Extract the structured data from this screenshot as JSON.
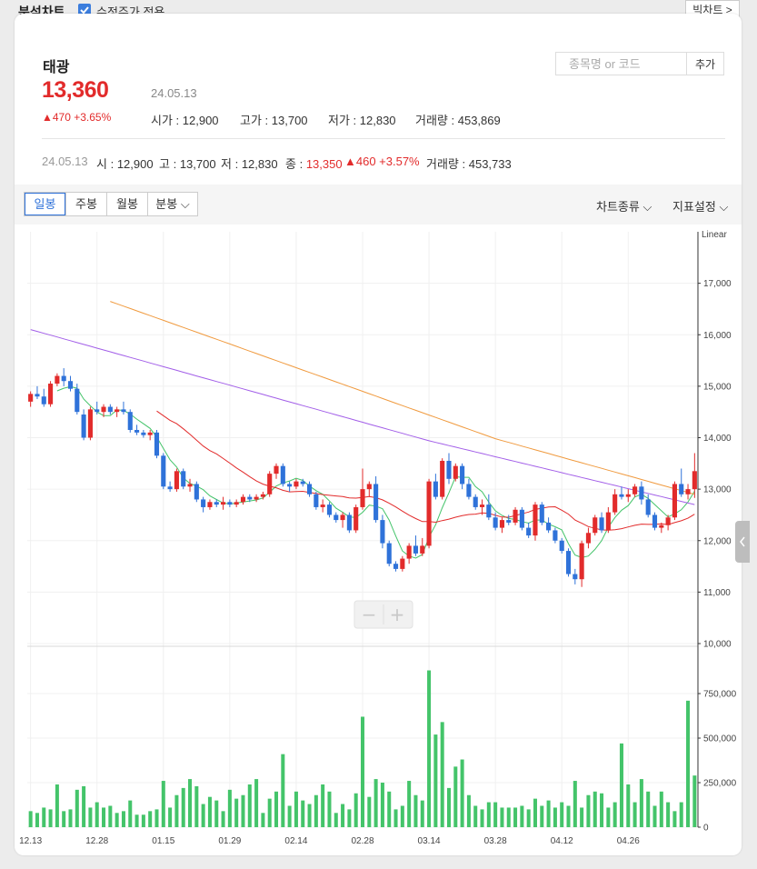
{
  "top": {
    "title": "분석차트",
    "checkbox_label": "수정주가 적용",
    "checkbox_checked": true,
    "big_chart_button": "빅차트 >"
  },
  "stock": {
    "name": "태광",
    "price": "13,360",
    "date": "24.05.13",
    "change": "▲470 +3.65%",
    "open_label": "시가",
    "open": "12,900",
    "high_label": "고가",
    "high": "13,700",
    "low_label": "저가",
    "low": "12,830",
    "vol_label": "거래량",
    "vol": "453,869"
  },
  "search": {
    "placeholder": "종목명 or 코드",
    "add_button": "추가"
  },
  "summary": {
    "date": "24.05.13",
    "o_label": "시",
    "o": "12,900",
    "h_label": "고",
    "h": "13,700",
    "l_label": "저",
    "l": "12,830",
    "c_label": "종",
    "c": "13,350",
    "chg": "▲460 +3.57%",
    "v_label": "거래량",
    "v": "453,733"
  },
  "tabs": {
    "items": [
      "일봉",
      "주봉",
      "월봉",
      "분봉"
    ],
    "active": 0
  },
  "controls": {
    "chart_type": "차트종류",
    "indicator": "지표설정"
  },
  "colors": {
    "up": "#e22b2b",
    "down": "#2f72d9",
    "volume": "#44c46a",
    "ma5": "#44c46a",
    "ma20": "#e22b2b",
    "ma60": "#a25ee8",
    "ma120": "#f09a3e",
    "accent": "#2f72d9"
  },
  "zoom": {
    "minus": "−",
    "plus": "+"
  },
  "chart_data": {
    "type": "candlestick",
    "scale_label": "Linear",
    "price_ticks": [
      "10,000",
      "11,000",
      "12,000",
      "13,000",
      "14,000",
      "15,000",
      "16,000",
      "17,000"
    ],
    "price_range": [
      10000,
      18000
    ],
    "volume_ticks": [
      "0",
      "250,000",
      "500,000",
      "750,000"
    ],
    "volume_range": [
      0,
      1000000
    ],
    "x_labels": [
      {
        "i": 0,
        "label": "12.13"
      },
      {
        "i": 10,
        "label": "12.28"
      },
      {
        "i": 20,
        "label": "01.15"
      },
      {
        "i": 30,
        "label": "01.29"
      },
      {
        "i": 40,
        "label": "02.14"
      },
      {
        "i": 50,
        "label": "02.28"
      },
      {
        "i": 60,
        "label": "03.14"
      },
      {
        "i": 70,
        "label": "03.28"
      },
      {
        "i": 80,
        "label": "04.12"
      },
      {
        "i": 90,
        "label": "04.26"
      }
    ],
    "candles": [
      [
        14700,
        14900,
        14600,
        14850
      ],
      [
        14850,
        15000,
        14750,
        14800
      ],
      [
        14800,
        14950,
        14600,
        14650
      ],
      [
        14650,
        15100,
        14600,
        15050
      ],
      [
        15050,
        15250,
        15000,
        15200
      ],
      [
        15200,
        15350,
        15000,
        15100
      ],
      [
        15100,
        15200,
        14900,
        14950
      ],
      [
        14950,
        15050,
        14450,
        14500
      ],
      [
        14450,
        14550,
        13950,
        14000
      ],
      [
        14000,
        14600,
        13950,
        14550
      ],
      [
        14550,
        14700,
        14450,
        14500
      ],
      [
        14500,
        14650,
        14400,
        14600
      ],
      [
        14600,
        14650,
        14450,
        14500
      ],
      [
        14500,
        14600,
        14400,
        14550
      ],
      [
        14550,
        14700,
        14450,
        14500
      ],
      [
        14500,
        14550,
        14100,
        14150
      ],
      [
        14150,
        14250,
        14050,
        14100
      ],
      [
        14100,
        14150,
        14000,
        14050
      ],
      [
        14050,
        14150,
        13950,
        14100
      ],
      [
        14100,
        14150,
        13600,
        13650
      ],
      [
        13650,
        13700,
        13000,
        13050
      ],
      [
        13050,
        13150,
        12950,
        13000
      ],
      [
        13000,
        13400,
        12950,
        13350
      ],
      [
        13350,
        13400,
        13000,
        13050
      ],
      [
        13050,
        13200,
        12950,
        13100
      ],
      [
        13100,
        13150,
        12750,
        12800
      ],
      [
        12800,
        12850,
        12550,
        12650
      ],
      [
        12650,
        12800,
        12600,
        12750
      ],
      [
        12750,
        12800,
        12650,
        12700
      ],
      [
        12700,
        12850,
        12600,
        12750
      ],
      [
        12750,
        12800,
        12650,
        12700
      ],
      [
        12700,
        12800,
        12650,
        12750
      ],
      [
        12750,
        12900,
        12700,
        12850
      ],
      [
        12850,
        12900,
        12750,
        12800
      ],
      [
        12800,
        12900,
        12750,
        12850
      ],
      [
        12850,
        12950,
        12800,
        12900
      ],
      [
        12900,
        13350,
        12850,
        13300
      ],
      [
        13300,
        13500,
        13200,
        13450
      ],
      [
        13450,
        13500,
        13050,
        13100
      ],
      [
        13100,
        13150,
        12950,
        13050
      ],
      [
        13050,
        13200,
        13000,
        13150
      ],
      [
        13150,
        13200,
        13050,
        13100
      ],
      [
        13100,
        13150,
        12850,
        12900
      ],
      [
        12900,
        12950,
        12600,
        12650
      ],
      [
        12650,
        12800,
        12550,
        12700
      ],
      [
        12700,
        12750,
        12450,
        12500
      ],
      [
        12500,
        12550,
        12350,
        12400
      ],
      [
        12400,
        12550,
        12250,
        12500
      ],
      [
        12500,
        12550,
        12150,
        12200
      ],
      [
        12200,
        12700,
        12150,
        12650
      ],
      [
        12650,
        13400,
        12600,
        13000
      ],
      [
        13000,
        13150,
        12850,
        13100
      ],
      [
        13100,
        13250,
        12350,
        12400
      ],
      [
        12400,
        12500,
        11850,
        11950
      ],
      [
        11950,
        12000,
        11500,
        11550
      ],
      [
        11550,
        11600,
        11400,
        11450
      ],
      [
        11450,
        11700,
        11400,
        11650
      ],
      [
        11650,
        11950,
        11550,
        11900
      ],
      [
        11900,
        12100,
        11700,
        11750
      ],
      [
        11750,
        12050,
        11700,
        11900
      ],
      [
        11900,
        13200,
        11850,
        13150
      ],
      [
        13150,
        13300,
        12800,
        12850
      ],
      [
        12850,
        13600,
        12800,
        13550
      ],
      [
        13550,
        13700,
        13100,
        13200
      ],
      [
        13200,
        13500,
        13150,
        13450
      ],
      [
        13450,
        13500,
        13000,
        13100
      ],
      [
        13100,
        13200,
        12800,
        12850
      ],
      [
        12850,
        12900,
        12600,
        12650
      ],
      [
        12650,
        12800,
        12500,
        12700
      ],
      [
        12700,
        12900,
        12400,
        12450
      ],
      [
        12450,
        12550,
        12200,
        12250
      ],
      [
        12250,
        12450,
        12150,
        12400
      ],
      [
        12400,
        12500,
        12300,
        12350
      ],
      [
        12350,
        12650,
        12300,
        12600
      ],
      [
        12600,
        12650,
        12200,
        12250
      ],
      [
        12250,
        12350,
        12050,
        12100
      ],
      [
        12100,
        12750,
        12000,
        12700
      ],
      [
        12700,
        12750,
        12300,
        12350
      ],
      [
        12350,
        12450,
        12150,
        12200
      ],
      [
        12200,
        12250,
        11950,
        12000
      ],
      [
        12000,
        12050,
        11750,
        11800
      ],
      [
        11800,
        11850,
        11300,
        11350
      ],
      [
        11350,
        11450,
        11150,
        11250
      ],
      [
        11250,
        12000,
        11100,
        11950
      ],
      [
        11950,
        12250,
        11850,
        12150
      ],
      [
        12150,
        12500,
        12100,
        12450
      ],
      [
        12450,
        12550,
        12150,
        12200
      ],
      [
        12200,
        12650,
        12150,
        12550
      ],
      [
        12550,
        13000,
        12500,
        12900
      ],
      [
        12900,
        13050,
        12800,
        12850
      ],
      [
        12850,
        13000,
        12750,
        12900
      ],
      [
        12900,
        13100,
        12850,
        13050
      ],
      [
        13050,
        13150,
        12700,
        12800
      ],
      [
        12800,
        12900,
        12450,
        12500
      ],
      [
        12500,
        12550,
        12200,
        12250
      ],
      [
        12250,
        12350,
        12150,
        12300
      ],
      [
        12300,
        12500,
        12200,
        12450
      ],
      [
        12450,
        13150,
        12400,
        13100
      ],
      [
        13100,
        13400,
        12850,
        12900
      ],
      [
        12900,
        13100,
        12800,
        13000
      ],
      [
        13000,
        13700,
        12830,
        13350
      ]
    ],
    "volume": [
      90000,
      80000,
      110000,
      100000,
      240000,
      90000,
      100000,
      210000,
      230000,
      110000,
      140000,
      110000,
      120000,
      80000,
      90000,
      150000,
      70000,
      70000,
      90000,
      100000,
      260000,
      110000,
      180000,
      220000,
      270000,
      230000,
      130000,
      170000,
      150000,
      90000,
      210000,
      160000,
      180000,
      240000,
      270000,
      80000,
      160000,
      200000,
      410000,
      120000,
      200000,
      150000,
      130000,
      180000,
      240000,
      200000,
      80000,
      130000,
      100000,
      190000,
      620000,
      170000,
      270000,
      250000,
      200000,
      100000,
      120000,
      260000,
      180000,
      150000,
      880000,
      520000,
      590000,
      220000,
      340000,
      380000,
      180000,
      120000,
      100000,
      140000,
      140000,
      110000,
      110000,
      110000,
      120000,
      100000,
      160000,
      120000,
      150000,
      110000,
      140000,
      120000,
      260000,
      110000,
      180000,
      200000,
      190000,
      110000,
      140000,
      470000,
      240000,
      140000,
      270000,
      200000,
      120000,
      200000,
      140000,
      90000,
      140000,
      710000,
      290000,
      210000,
      460000
    ]
  }
}
